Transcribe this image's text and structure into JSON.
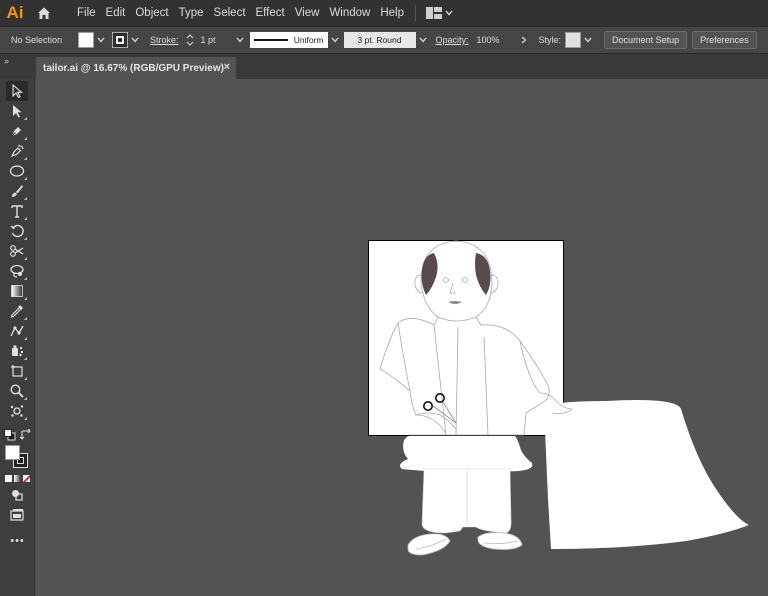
{
  "app": {
    "logo": "Ai"
  },
  "menu": {
    "items": [
      "File",
      "Edit",
      "Object",
      "Type",
      "Select",
      "Effect",
      "View",
      "Window",
      "Help"
    ]
  },
  "control_bar": {
    "selection_status": "No Selection",
    "stroke_label": "Stroke:",
    "stroke_weight": "1 pt",
    "variable_width_profile": "Uniform",
    "brush_definition": "3 pt. Round",
    "opacity_label": "Opacity:",
    "opacity_value": "100%",
    "style_label": "Style:",
    "document_setup_button": "Document Setup",
    "preferences_button": "Preferences"
  },
  "document_tab": {
    "title": "tailor.ai @ 16.67% (RGB/GPU Preview)",
    "close_glyph": "×"
  },
  "panel_grip": "»",
  "toolbar": {
    "more_tools": "•••",
    "tools": [
      "selection-tool",
      "direct-selection-tool",
      "pen-tool",
      "curvature-tool",
      "ellipse-tool",
      "paintbrush-tool",
      "type-tool",
      "rotate-tool",
      "scissors-tool",
      "lasso-tool",
      "gradient-tool",
      "eyedropper-tool",
      "puppet-warp-tool",
      "symbol-sprayer-tool",
      "artboard-tool",
      "zoom-tool",
      "scatter-tool"
    ]
  },
  "colors": {
    "menubar": "#323232",
    "controlbar": "#454545",
    "canvas": "#535353",
    "toolbar": "#3e3e3e",
    "accent_logo": "#f79500",
    "hair_fill": "#5a4a4c"
  }
}
